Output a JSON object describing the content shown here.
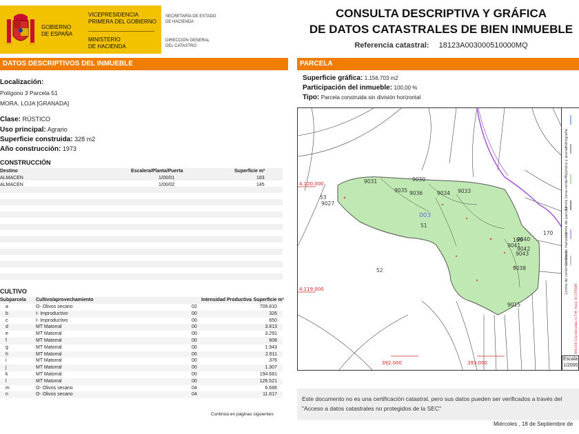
{
  "header": {
    "gov_name": [
      "GOBIERNO",
      "DE ESPAÑA"
    ],
    "vice": [
      "VICEPRESIDENCIA",
      "PRIMERA DEL GOBIERNO"
    ],
    "ministry": [
      "MINISTERIO",
      "DE HACIENDA"
    ],
    "secretaria": [
      "SECRETARÍA DE ESTADO",
      "DE HACIENDA"
    ],
    "direccion": [
      "DIRECCIÓN GENERAL",
      "DEL CATASTRO"
    ],
    "title_line1": "CONSULTA DESCRIPTIVA Y GRÁFICA",
    "title_line2": "DE DATOS CATASTRALES DE BIEN INMUEBLE",
    "ref_label": "Referencia catastral:",
    "ref_value": "18123A003000510000MQ"
  },
  "left": {
    "bar": "DATOS DESCRIPTIVOS DEL INMUEBLE",
    "localizacion_label": "Localización:",
    "localizacion_line1": "Polígono 3 Parcela 51",
    "localizacion_line2": "MORA. LOJA [GRANADA]",
    "clase_label": "Clase:",
    "clase_value": "RÚSTICO",
    "uso_label": "Uso principal:",
    "uso_value": "Agrario",
    "sup_label": "Superficie construida:",
    "sup_value": "328 m2",
    "anio_label": "Año construcción:",
    "anio_value": "1973",
    "construccion_title": "CONSTRUCCIÓN",
    "construccion_headers": [
      "Destino",
      "Escalera/Planta/Puerta",
      "Superficie m²"
    ],
    "construccion_rows": [
      [
        "ALMACEN",
        "1/00/01",
        "183"
      ],
      [
        "ALMACEN",
        "1/00/02",
        "145"
      ]
    ],
    "cultivo_title": "CULTIVO",
    "cultivo_headers": [
      "Subparcela",
      "Cultivo/aprovechamiento",
      "Intensidad Productiva",
      "Superficie m²"
    ],
    "cultivo_rows": [
      [
        "a",
        "O- Olivos secano",
        "02",
        "709.810"
      ],
      [
        "b",
        "I- Improductivo",
        "00",
        "326"
      ],
      [
        "c",
        "I- Improductivo",
        "00",
        "650"
      ],
      [
        "d",
        "MT Matorral",
        "00",
        "3.813"
      ],
      [
        "e",
        "MT Matorral",
        "00",
        "3.291"
      ],
      [
        "f",
        "MT Matorral",
        "00",
        "608"
      ],
      [
        "g",
        "MT Matorral",
        "00",
        "1.943"
      ],
      [
        "h",
        "MT Matorral",
        "00",
        "2.611"
      ],
      [
        "i",
        "MT Matorral",
        "00",
        "376"
      ],
      [
        "j",
        "MT Matorral",
        "00",
        "1.307"
      ],
      [
        "k",
        "MT Matorral",
        "00",
        "194.681"
      ],
      [
        "l",
        "MT Matorral",
        "00",
        "126.521"
      ],
      [
        "m",
        "O- Olivos secano",
        "04",
        "6.686"
      ],
      [
        "n",
        "O- Olivos secano",
        "04",
        "11.617"
      ]
    ],
    "continua": "Continúa en páginas siguientes"
  },
  "right": {
    "bar": "PARCELA",
    "sup_grafica_label": "Superficie gráfica:",
    "sup_grafica_value": "1.156.703 m2",
    "participacion_label": "Participación del inmueble:",
    "participacion_value": "100,00 %",
    "tipo_label": "Tipo:",
    "tipo_value": "Parcela construida sin división horizontal",
    "map": {
      "labels": [
        "9031",
        "9030",
        "9035",
        "9036",
        "9034",
        "9033",
        "003",
        "51",
        "53",
        "9027",
        "52",
        "169",
        "170",
        "9040",
        "9041",
        "9042",
        "9043",
        "9038",
        "9015"
      ],
      "coords": [
        "4.120.000",
        "4.119.000",
        "392.000",
        "393.000"
      ],
      "legend": [
        "Hidrografía",
        "Mojonera y aceras",
        "Límite zona verde",
        "Límite de parcela",
        "Límite de manzana",
        "Límite de construcciones"
      ],
      "crs": "394.000 Coordenadas U.T.M. Huso 30 ETRS89",
      "scale": [
        "Escala",
        "1/2000"
      ],
      "fill_color": "#bfe8b2"
    },
    "footer": "Este documento no es una certificación catastral, pero sus datos pueden ser verificados a través del \"Acceso a datos catastrales no protegidos de la SEC\"",
    "date": "Miércoles , 18 de Septiembre de"
  }
}
